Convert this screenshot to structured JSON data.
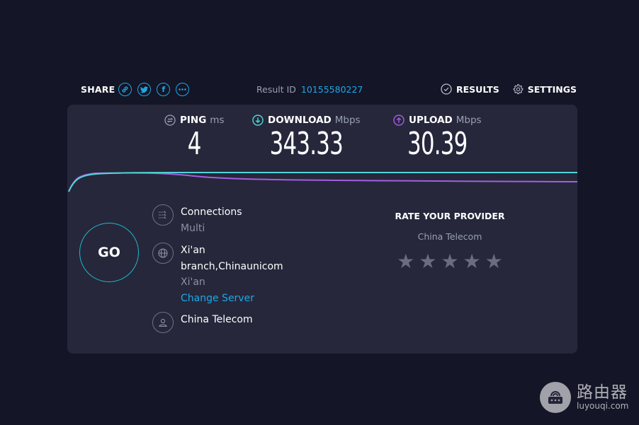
{
  "header": {
    "share_label": "SHARE",
    "share_icons": [
      "link-icon",
      "twitter-icon",
      "facebook-icon",
      "more-icon"
    ],
    "result_id_label": "Result ID",
    "result_id": "10155580227",
    "results_label": "RESULTS",
    "settings_label": "SETTINGS"
  },
  "metrics": {
    "ping": {
      "label": "PING",
      "unit": "ms",
      "value": "4"
    },
    "download": {
      "label": "DOWNLOAD",
      "unit": "Mbps",
      "value": "343.33"
    },
    "upload": {
      "label": "UPLOAD",
      "unit": "Mbps",
      "value": "30.39"
    }
  },
  "colors": {
    "accent": "#1ea8e6",
    "download": "#4fd6d6",
    "upload": "#a35fe0",
    "panel": "#26273b",
    "background": "#141526"
  },
  "go_label": "GO",
  "info": {
    "connections_label": "Connections",
    "connections_value": "Multi",
    "server_name_line1": "Xi'an",
    "server_name_line2": "branch,Chinaunicom",
    "server_location": "Xi'an",
    "change_server": "Change Server",
    "provider": "China Telecom"
  },
  "rate": {
    "title": "RATE YOUR PROVIDER",
    "provider": "China Telecom",
    "stars_total": 5,
    "stars_selected": 0
  },
  "watermark": {
    "cn": "路由器",
    "en": "luyouqi.com"
  }
}
